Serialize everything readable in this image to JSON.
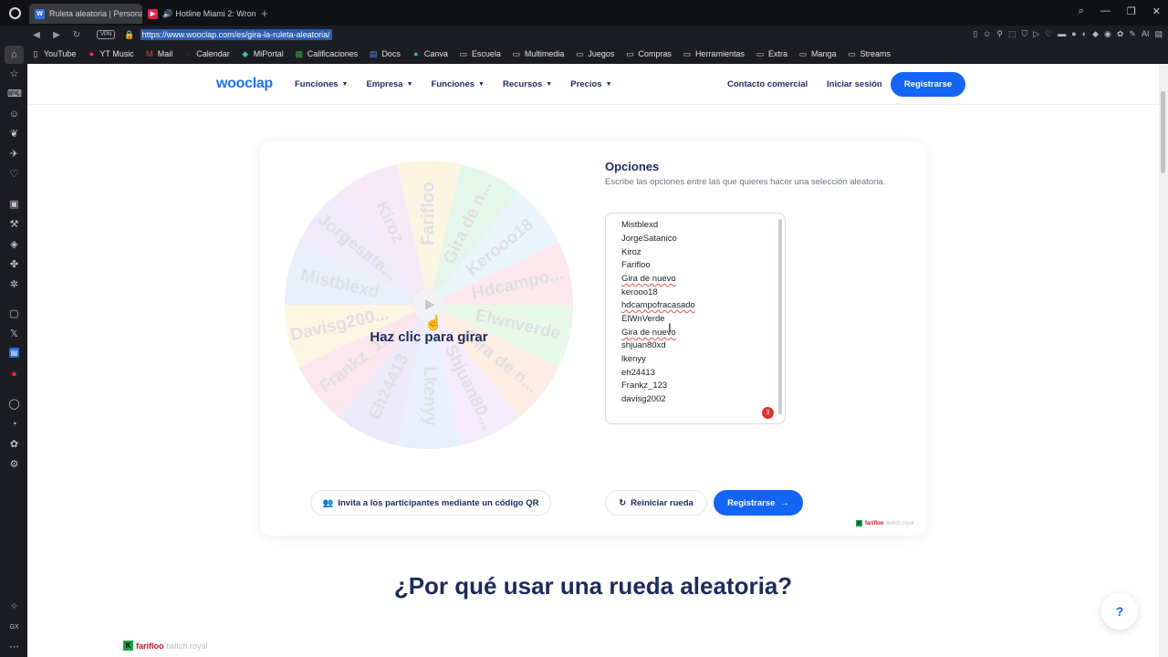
{
  "browser": {
    "tabs": [
      {
        "title": "Ruleta aleatoria | Personal",
        "favicon": "W",
        "active": true
      },
      {
        "title": "Hotline Miami 2: Wrong",
        "favicon": "▶",
        "active": false
      }
    ],
    "url": "https://www.wooclap.com/es/gira-la-ruleta-aleatoria/",
    "vpn_label": "VPN",
    "bookmarks": [
      {
        "label": "YouTube",
        "icon": "file-icon"
      },
      {
        "label": "YT Music",
        "icon": "ytmusic-icon"
      },
      {
        "label": "Mail",
        "icon": "gmail-icon"
      },
      {
        "label": "Calendar",
        "icon": "calendar-icon"
      },
      {
        "label": "MiPortal",
        "icon": "portal-icon"
      },
      {
        "label": "Calificaciones",
        "icon": "sheets-icon"
      },
      {
        "label": "Docs",
        "icon": "docs-icon"
      },
      {
        "label": "Canva",
        "icon": "canva-icon"
      },
      {
        "label": "Escuela",
        "icon": "folder-icon"
      },
      {
        "label": "Multimedia",
        "icon": "folder-icon"
      },
      {
        "label": "Juegos",
        "icon": "folder-icon"
      },
      {
        "label": "Compras",
        "icon": "folder-icon"
      },
      {
        "label": "Herramientas",
        "icon": "folder-icon"
      },
      {
        "label": "Extra",
        "icon": "folder-icon"
      },
      {
        "label": "Manga",
        "icon": "folder-icon"
      },
      {
        "label": "Streams",
        "icon": "folder-icon"
      }
    ]
  },
  "site": {
    "logo": "wooclap",
    "menu": [
      "Funciones",
      "Empresa",
      "Funciones",
      "Recursos",
      "Precios"
    ],
    "contact": "Contacto comercial",
    "login": "Iniciar sesión",
    "signup": "Registrarse"
  },
  "wheel": {
    "spin_label": "Haz clic para girar",
    "segments": [
      "Farifloo",
      "Gira de n...",
      "Kerooo18",
      "Hdcampo...",
      "Elwnverde",
      "Gira de n...",
      "Shjuan80...",
      "Lkenyy",
      "Eh24413",
      "Frankz_1...",
      "Davisg200...",
      "Mistblexd",
      "Jorgesata...",
      "Kiroz"
    ],
    "colors": [
      "#fbf0d3",
      "#d8f3e0",
      "#dff1fb",
      "#fbdce3",
      "#dcf6dc",
      "#fde4d6",
      "#efe2fb",
      "#dbe9fb",
      "#e4dff8",
      "#fbdbe6",
      "#fbf2d4",
      "#dfe6fb",
      "#e6e0f8",
      "#f3dff3"
    ]
  },
  "options": {
    "title": "Opciones",
    "description": "Escribe las opciones entre las que quieres hacer una selección aleatoria.",
    "entries": [
      "Mistblexd",
      "JorgeSatanico",
      "Kiroz",
      "Farifloo",
      "Gira de nuevo",
      "kerooo18",
      "hdcampofracasado",
      "ElWnVerde",
      "Gira de nuevo",
      "shjuan80xd",
      "lkenyy",
      "eh24413",
      "Frankz_123",
      "davisg2002"
    ],
    "badge_count": "3"
  },
  "actions": {
    "invite": "Invita a los participantes mediante un código QR",
    "reset": "Reiniciar rueda",
    "signup": "Registrarse"
  },
  "watermark": {
    "name": "farifloo",
    "tag": "twitch royal"
  },
  "section": {
    "title": "¿Por qué usar una rueda aleatoria?"
  },
  "help": {
    "label": "?"
  },
  "colors": {
    "accent": "#1464f6",
    "navy": "#1d2b5c",
    "logo": "#1d74e8"
  }
}
